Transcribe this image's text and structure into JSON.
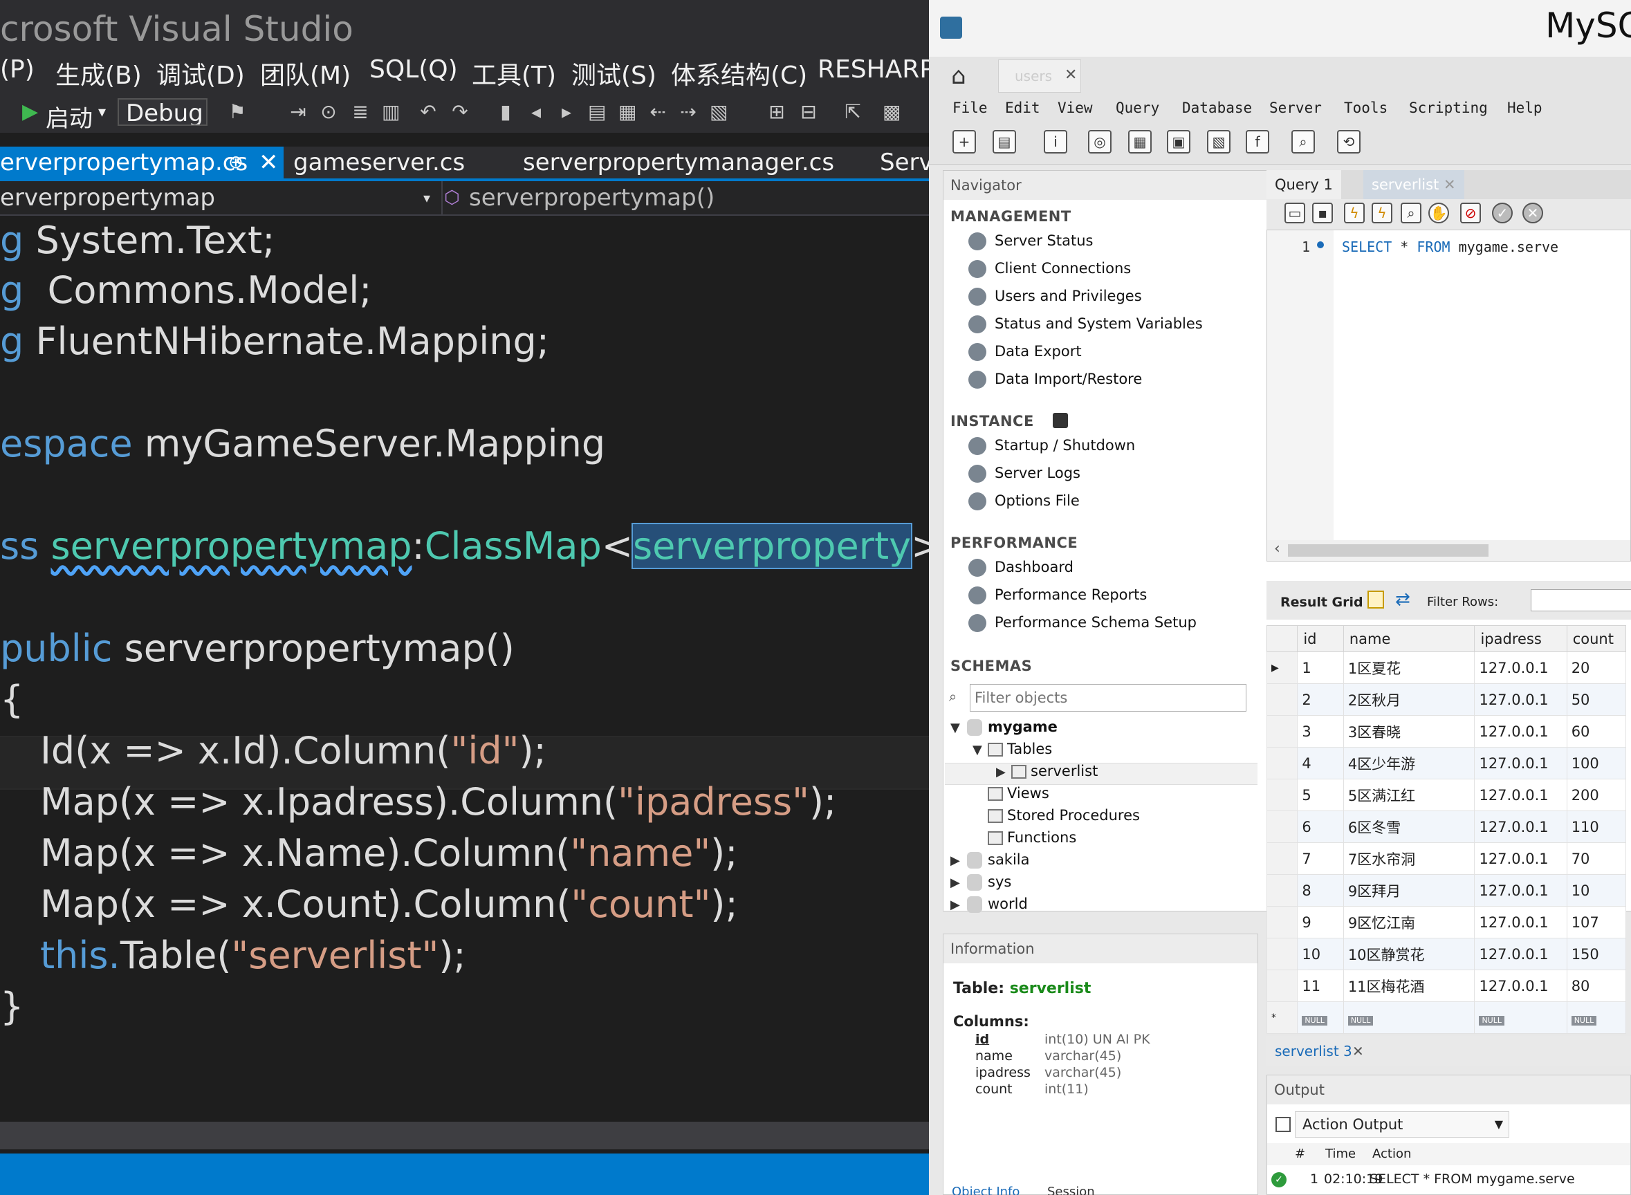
{
  "vs": {
    "title": "crosoft Visual Studio",
    "menu": [
      "(P)",
      "生成(B)",
      "调试(D)",
      "团队(M)",
      "SQL(Q)",
      "工具(T)",
      "测试(S)",
      "体系结构(C)",
      "RESHARPER"
    ],
    "toolbar": {
      "start_label": "启动",
      "config_label": "Debug"
    },
    "tabs": [
      {
        "label": "erverpropertymap.cs",
        "pin": "⊕",
        "close": "✕"
      },
      {
        "label": "gameserver.cs"
      },
      {
        "label": "serverpropertymanager.cs"
      },
      {
        "label": "Serve"
      }
    ],
    "nav": {
      "left": "erverpropertymap",
      "right": "serverpropertymap()"
    },
    "code": {
      "l1": {
        "kw": "g",
        "text": " System.Text;"
      },
      "l2": {
        "kw": "g",
        "text": "  Commons.Model;"
      },
      "l3": {
        "kw": "g",
        "text": " FluentNHibernate.Mapping;"
      },
      "l5": {
        "kw": "espace",
        "text": " myGameServer.Mapping"
      },
      "l7": {
        "kw": "ss",
        "name": "serverpropertymap",
        "colon": ":",
        "base": "ClassMap",
        "lt": "<",
        "generic": "serverproperty",
        "gt": ">"
      },
      "l9": {
        "kw": "public",
        "text": " serverpropertymap()"
      },
      "l10": "{",
      "l11": {
        "a": "Id(x => x.Id).Column(",
        "s": "\"id\"",
        "b": ");"
      },
      "l12": {
        "a": "Map(x => x.Ipadress).Column(",
        "s": "\"ipadress\"",
        "b": ");"
      },
      "l13": {
        "a": "Map(x => x.Name).Column(",
        "s": "\"name\"",
        "b": ");"
      },
      "l14": {
        "a": "Map(x => x.Count).Column(",
        "s": "\"count\"",
        "b": ");"
      },
      "l15": {
        "kw": "this.",
        "a": "Table(",
        "s": "\"serverlist\"",
        "b": ");"
      },
      "l16": "}"
    }
  },
  "wb": {
    "app_title": "MySQ",
    "conn_tab": "users",
    "menu": [
      "File",
      "Edit",
      "View",
      "Query",
      "Database",
      "Server",
      "Tools",
      "Scripting",
      "Help"
    ],
    "navigator": {
      "title": "Navigator",
      "management": {
        "title": "MANAGEMENT",
        "items": [
          "Server Status",
          "Client Connections",
          "Users and Privileges",
          "Status and System Variables",
          "Data Export",
          "Data Import/Restore"
        ]
      },
      "instance": {
        "title": "INSTANCE",
        "items": [
          "Startup / Shutdown",
          "Server Logs",
          "Options File"
        ]
      },
      "performance": {
        "title": "PERFORMANCE",
        "items": [
          "Dashboard",
          "Performance Reports",
          "Performance Schema Setup"
        ]
      },
      "schemas": {
        "title": "SCHEMAS",
        "filter_placeholder": "Filter objects",
        "tree": [
          "mygame",
          "Tables",
          "serverlist",
          "Views",
          "Stored Procedures",
          "Functions",
          "sakila",
          "sys",
          "world"
        ]
      }
    },
    "information": {
      "title": "Information",
      "table_label": "Table:",
      "table_name": "serverlist",
      "columns_label": "Columns:",
      "columns": [
        {
          "name": "id",
          "type": "int(10) UN AI PK"
        },
        {
          "name": "name",
          "type": "varchar(45)"
        },
        {
          "name": "ipadress",
          "type": "varchar(45)"
        },
        {
          "name": "count",
          "type": "int(11)"
        }
      ],
      "tabs": [
        "Object Info",
        "Session"
      ]
    },
    "query_tabs": [
      "Query 1",
      "serverlist"
    ],
    "editor": {
      "line_no": "1",
      "sql_kw1": "SELECT",
      "sql_star": " * ",
      "sql_kw2": "FROM",
      "sql_rest": " mygame.serve"
    },
    "result": {
      "label": "Result Grid",
      "filter_label": "Filter Rows:",
      "headers": [
        "id",
        "name",
        "ipadress",
        "count"
      ],
      "rows": [
        [
          "1",
          "1区夏花",
          "127.0.0.1",
          "20"
        ],
        [
          "2",
          "2区秋月",
          "127.0.0.1",
          "50"
        ],
        [
          "3",
          "3区春晓",
          "127.0.0.1",
          "60"
        ],
        [
          "4",
          "4区少年游",
          "127.0.0.1",
          "100"
        ],
        [
          "5",
          "5区满江红",
          "127.0.0.1",
          "200"
        ],
        [
          "6",
          "6区冬雪",
          "127.0.0.1",
          "110"
        ],
        [
          "7",
          "7区水帘洞",
          "127.0.0.1",
          "70"
        ],
        [
          "8",
          "9区拜月",
          "127.0.0.1",
          "10"
        ],
        [
          "9",
          "9区忆江南",
          "127.0.0.1",
          "107"
        ],
        [
          "10",
          "10区静赏花",
          "127.0.0.1",
          "150"
        ],
        [
          "11",
          "11区梅花酒",
          "127.0.0.1",
          "80"
        ]
      ],
      "null_label": "NULL",
      "result_tab": "serverlist 3"
    },
    "output": {
      "title": "Output",
      "selector": "Action Output",
      "headers": [
        "#",
        "Time",
        "Action"
      ],
      "row": {
        "num": "1",
        "time": "02:10:19",
        "action": "SELECT * FROM mygame.serve"
      }
    }
  }
}
